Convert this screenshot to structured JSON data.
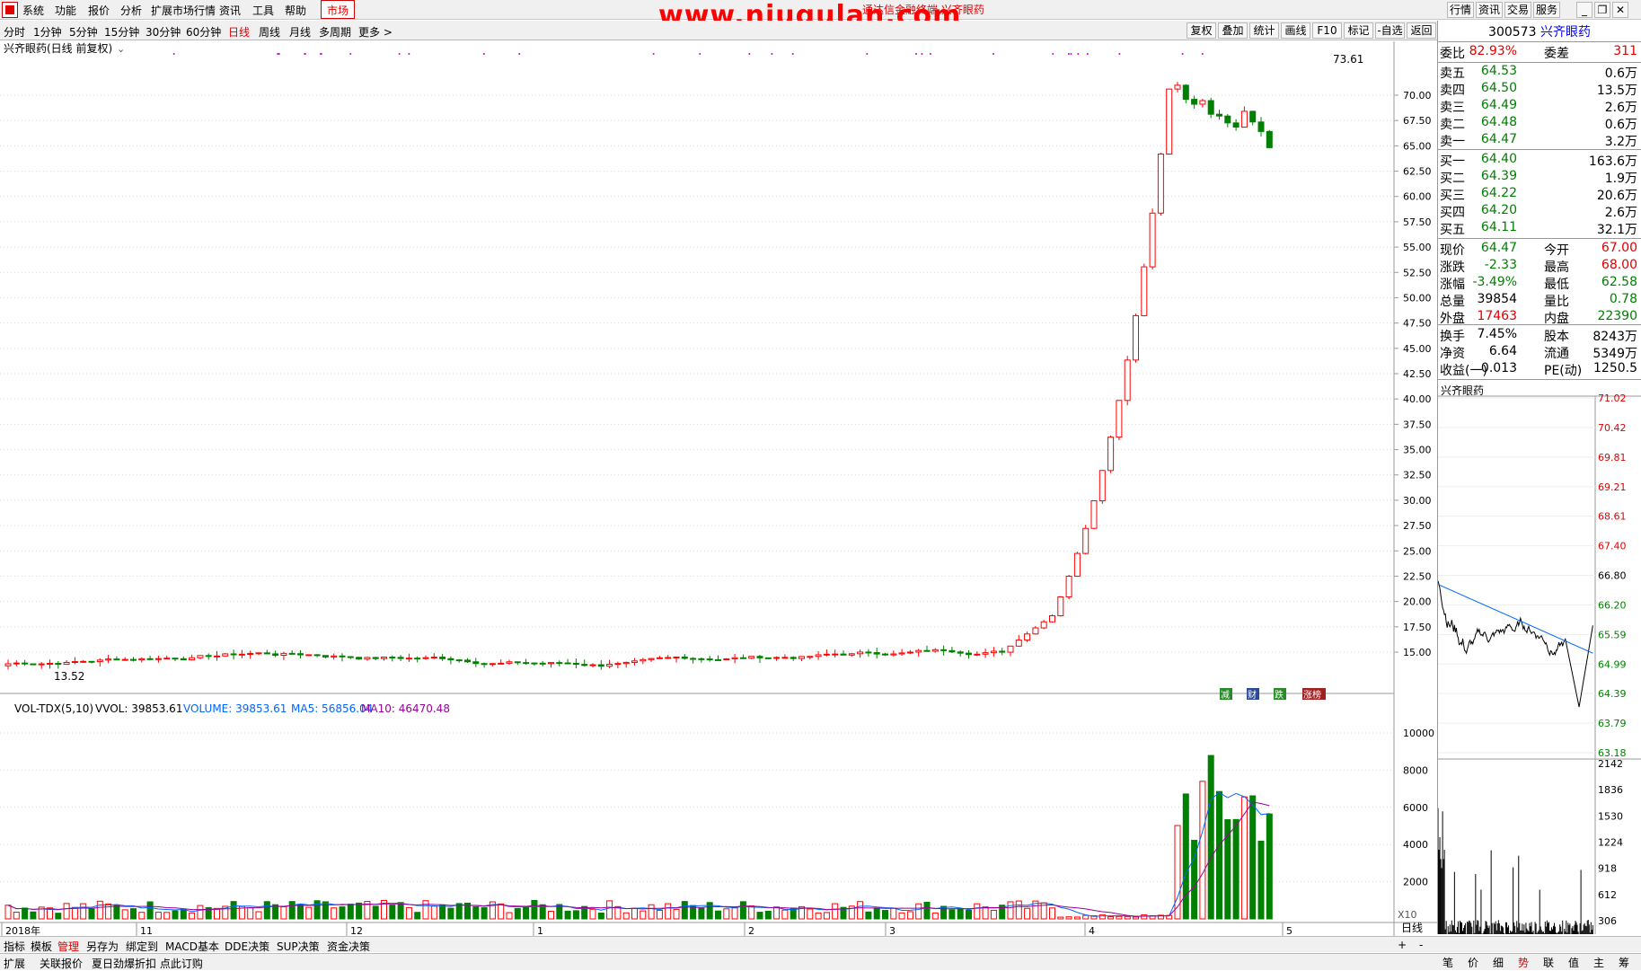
{
  "menu": {
    "items": [
      "系统",
      "功能",
      "报价",
      "分析",
      "扩展市场行情",
      "资讯",
      "工具",
      "帮助"
    ],
    "market": "市场"
  },
  "watermark": "www.niugulan.com",
  "window_subtitle": "通达信金融终端 兴齐眼药",
  "right_tabs": [
    "行情",
    "资讯",
    "交易",
    "服务"
  ],
  "periods": [
    "分时",
    "1分钟",
    "5分钟",
    "15分钟",
    "30分钟",
    "60分钟",
    "日线",
    "周线",
    "月线",
    "多周期",
    "更多 >"
  ],
  "active_period": "日线",
  "tools": [
    "复权",
    "叠加",
    "统计",
    "画线",
    "F10",
    "标记",
    "-自选",
    "返回"
  ],
  "chart": {
    "stock_title": "兴齐眼药(日线 前复权)",
    "high_label": "73.61",
    "low_label": "13.52",
    "price_axis": [
      "70.00",
      "67.50",
      "65.00",
      "62.50",
      "60.00",
      "57.50",
      "55.00",
      "52.50",
      "50.00",
      "47.50",
      "45.00",
      "42.50",
      "40.00",
      "37.50",
      "35.00",
      "32.50",
      "30.00",
      "27.50",
      "25.00",
      "22.50",
      "20.00",
      "17.50",
      "15.00"
    ],
    "badges": [
      "减",
      "财",
      "跌",
      "涨榜"
    ],
    "vol_legend": {
      "name": "VOL-TDX(5,10)",
      "vvol": "VVOL: 39853.61",
      "volume": "VOLUME: 39853.61",
      "ma5": "MA5: 56856.04",
      "ma10": "MA10: 46470.48"
    },
    "vol_axis": [
      "10000",
      "8000",
      "6000",
      "4000",
      "2000"
    ],
    "vol_unit": "X10",
    "x_labels": [
      "2018年",
      "11",
      "12",
      "1",
      "2",
      "3",
      "4",
      "5"
    ],
    "x_right": "日线",
    "colors": {
      "up": "#ff0000",
      "down": "#008000",
      "ma5": "#0066ff",
      "ma10": "#990099",
      "grid": "#d8d8d8"
    }
  },
  "bottom_tabs1": [
    "指标",
    "模板",
    "管理",
    "另存为",
    "绑定到",
    "MACD基本",
    "DDE决策",
    "SUP决策",
    "资金决策"
  ],
  "bottom_tabs1_active": "管理",
  "bottom_tabs2": [
    "扩展",
    "关联报价",
    "夏日劲爆折扣 点此订购"
  ],
  "quote": {
    "code": "300573",
    "name": "兴齐眼药",
    "weibi_label": "委比",
    "weibi": "82.93%",
    "weicha_label": "委差",
    "weicha": "311",
    "asks": [
      {
        "label": "卖五",
        "price": "64.53",
        "vol": "0.6万"
      },
      {
        "label": "卖四",
        "price": "64.50",
        "vol": "13.5万"
      },
      {
        "label": "卖三",
        "price": "64.49",
        "vol": "2.6万"
      },
      {
        "label": "卖二",
        "price": "64.48",
        "vol": "0.6万"
      },
      {
        "label": "卖一",
        "price": "64.47",
        "vol": "3.2万"
      }
    ],
    "bids": [
      {
        "label": "买一",
        "price": "64.40",
        "vol": "163.6万"
      },
      {
        "label": "买二",
        "price": "64.39",
        "vol": "1.9万"
      },
      {
        "label": "买三",
        "price": "64.22",
        "vol": "20.6万"
      },
      {
        "label": "买四",
        "price": "64.20",
        "vol": "2.6万"
      },
      {
        "label": "买五",
        "price": "64.11",
        "vol": "32.1万"
      }
    ],
    "stats": [
      {
        "l1": "现价",
        "v1": "64.47",
        "c1": "green",
        "l2": "今开",
        "v2": "67.00",
        "c2": "red"
      },
      {
        "l1": "涨跌",
        "v1": "-2.33",
        "c1": "green",
        "l2": "最高",
        "v2": "68.00",
        "c2": "red"
      },
      {
        "l1": "涨幅",
        "v1": "-3.49%",
        "c1": "green",
        "l2": "最低",
        "v2": "62.58",
        "c2": "green"
      },
      {
        "l1": "总量",
        "v1": "39854",
        "c1": "black",
        "l2": "量比",
        "v2": "0.78",
        "c2": "green"
      },
      {
        "l1": "外盘",
        "v1": "17463",
        "c1": "red",
        "l2": "内盘",
        "v2": "22390",
        "c2": "green"
      }
    ],
    "stats2": [
      {
        "l1": "换手",
        "v1": "7.45%",
        "l2": "股本",
        "v2": "8243万"
      },
      {
        "l1": "净资",
        "v1": "6.64",
        "l2": "流通",
        "v2": "5349万"
      },
      {
        "l1": "收益(一)",
        "v1": "0.013",
        "l2": "PE(动)",
        "v2": "1250.5"
      }
    ]
  },
  "mini": {
    "title": "兴齐眼药",
    "price_axis": [
      "71.02",
      "70.42",
      "69.81",
      "69.21",
      "68.61",
      "67.40",
      "66.80",
      "66.20",
      "65.59",
      "64.99",
      "64.39",
      "63.79",
      "63.18"
    ],
    "vol_axis": [
      "2142",
      "1836",
      "1530",
      "1224",
      "918",
      "612",
      "306"
    ]
  },
  "right_bottom_tabs": [
    "笔",
    "价",
    "细",
    "势",
    "联",
    "值",
    "主",
    "筹"
  ],
  "right_bottom_active": "势"
}
